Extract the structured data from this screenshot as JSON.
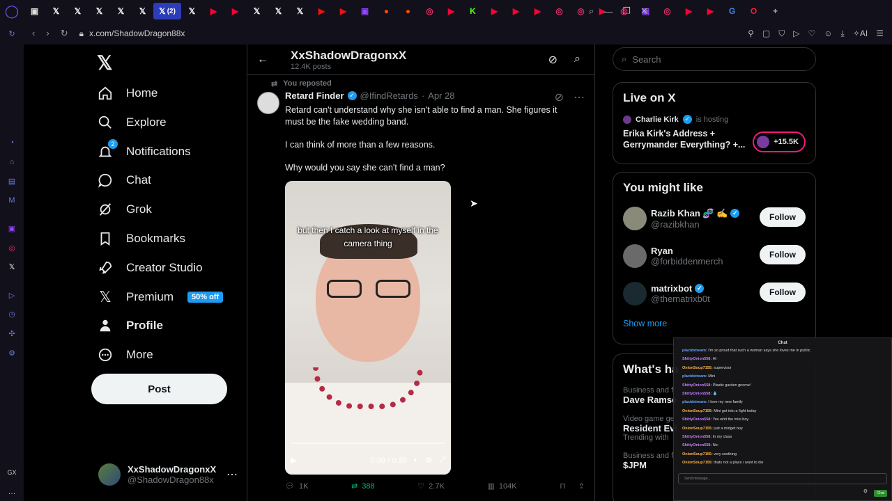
{
  "browser": {
    "tabs": [
      {
        "icon": "twitch-icon",
        "color": "#ddd"
      },
      {
        "icon": "x-icon",
        "color": "#fff"
      },
      {
        "icon": "x-icon",
        "color": "#fff"
      },
      {
        "icon": "x-icon",
        "color": "#fff"
      },
      {
        "icon": "x-icon",
        "color": "#fff"
      },
      {
        "icon": "x-icon",
        "color": "#fff"
      },
      {
        "icon": "x-icon-active",
        "color": "#fff"
      },
      {
        "icon": "x-icon",
        "color": "#fff"
      },
      {
        "icon": "youtube-icon",
        "color": "#ff0033"
      },
      {
        "icon": "youtube-icon",
        "color": "#ff0033"
      },
      {
        "icon": "x-icon",
        "color": "#fff"
      },
      {
        "icon": "x-icon",
        "color": "#fff"
      },
      {
        "icon": "x-icon",
        "color": "#fff"
      },
      {
        "icon": "play-icon",
        "color": "#e11"
      },
      {
        "icon": "play-icon",
        "color": "#e11"
      },
      {
        "icon": "twitch-icon",
        "color": "#9146ff"
      },
      {
        "icon": "reddit-icon",
        "color": "#ff4500"
      },
      {
        "icon": "reddit-icon",
        "color": "#ff4500"
      },
      {
        "icon": "instagram-icon",
        "color": "#e1306c"
      },
      {
        "icon": "youtube-icon",
        "color": "#ff0033"
      },
      {
        "icon": "kick-icon",
        "color": "#53fc18"
      },
      {
        "icon": "youtube-icon",
        "color": "#ff0033"
      },
      {
        "icon": "youtube-icon",
        "color": "#ff0033"
      },
      {
        "icon": "youtube-icon",
        "color": "#ff0033"
      },
      {
        "icon": "instagram-icon",
        "color": "#e1306c"
      },
      {
        "icon": "instagram-icon",
        "color": "#e1306c"
      },
      {
        "icon": "youtube-icon",
        "color": "#ff0033"
      },
      {
        "icon": "instagram-icon",
        "color": "#e1306c"
      },
      {
        "icon": "twitch-icon",
        "color": "#9146ff"
      },
      {
        "icon": "instagram-icon",
        "color": "#e1306c"
      },
      {
        "icon": "youtube-icon",
        "color": "#ff0033"
      },
      {
        "icon": "youtube-icon",
        "color": "#ff0033"
      },
      {
        "icon": "google-icon",
        "color": "#4285f4"
      },
      {
        "icon": "opera-icon",
        "color": "#ff1b2d"
      }
    ],
    "active_tab_count": "(2)",
    "url": "x.com/ShadowDragon88x",
    "ai_label": "AI"
  },
  "nav": {
    "items": [
      {
        "label": "Home",
        "icon": "home-icon"
      },
      {
        "label": "Explore",
        "icon": "search-icon"
      },
      {
        "label": "Notifications",
        "icon": "bell-icon",
        "badge": "2"
      },
      {
        "label": "Chat",
        "icon": "chat-icon"
      },
      {
        "label": "Grok",
        "icon": "grok-icon"
      },
      {
        "label": "Bookmarks",
        "icon": "bookmark-icon"
      },
      {
        "label": "Creator Studio",
        "icon": "rocket-icon"
      },
      {
        "label": "Premium",
        "icon": "x-logo-icon",
        "promo": "50% off"
      },
      {
        "label": "Profile",
        "icon": "person-icon"
      },
      {
        "label": "More",
        "icon": "more-circle-icon"
      }
    ],
    "post_label": "Post",
    "account": {
      "name": "XxShadowDragonxX",
      "handle": "@ShadowDragon88x"
    }
  },
  "profile_header": {
    "name": "XxShadowDragonxX",
    "posts": "12.4K posts"
  },
  "tweet": {
    "repost_note": "You reposted",
    "author": "Retard Finder",
    "handle": "@IfindRetards",
    "date": "Apr 28",
    "paragraphs": [
      "Retard can't understand why she isn't able to find a man. She figures it must be the fake wedding band.",
      "I can think of more than a few reasons.",
      "Why would you say she can't find a man?"
    ],
    "video": {
      "caption": "but then I catch a look at myself in the camera thing",
      "time": "0:00 / 0:39"
    },
    "replies": "1K",
    "reposts": "388",
    "likes": "2.7K",
    "views": "104K"
  },
  "search": {
    "placeholder": "Search"
  },
  "live": {
    "heading": "Live on X",
    "host": "Charlie Kirk",
    "hosting_label": "is hosting",
    "title": "Erika Kirk's Address + Gerrymander Everything? +...",
    "listeners": "+15.5K"
  },
  "suggestions": {
    "heading": "You might like",
    "people": [
      {
        "name": "Razib Khan 🧬 ✍️",
        "handle": "@razibkhan",
        "verified": true,
        "follow": "Follow"
      },
      {
        "name": "Ryan",
        "handle": "@forbiddenmerch",
        "verified": false,
        "follow": "Follow"
      },
      {
        "name": "matrixbot",
        "handle": "@thematrixb0t",
        "verified": true,
        "follow": "Follow"
      }
    ],
    "show_more": "Show more"
  },
  "trends": {
    "heading": "What's ha",
    "items": [
      {
        "category": "Business and f",
        "name": "Dave Ramse",
        "sub": ""
      },
      {
        "category": "Video game ge",
        "name": "Resident Evi",
        "sub": "Trending with"
      },
      {
        "category": "Business and f",
        "name": "$JPM",
        "sub": ""
      }
    ]
  },
  "chat": {
    "title": "Chat",
    "messages": [
      {
        "user": "placidstream:",
        "text": "I'm so proud that such a woman says she loves me in public.",
        "color": "#6aa7ff"
      },
      {
        "user": "ShittyOnion558:",
        "text": "Hi",
        "color": "#c77dff"
      },
      {
        "user": "OnionSoup7155:",
        "text": "supervisor",
        "color": "#ffb347"
      },
      {
        "user": "placidstream:",
        "text": "Mini",
        "color": "#6aa7ff"
      },
      {
        "user": "ShittyOnion558:",
        "text": "Plastic garden gnome!",
        "color": "#c77dff"
      },
      {
        "user": "ShittyOnion558:",
        "text": "💧",
        "color": "#c77dff"
      },
      {
        "user": "placidstream:",
        "text": "I love my new family",
        "color": "#6aa7ff"
      },
      {
        "user": "OnionSoup7155:",
        "text": "Mini got into a fight today",
        "color": "#ffb347"
      },
      {
        "user": "ShittyOnion558:",
        "text": "Yes whit the mini boy",
        "color": "#c77dff"
      },
      {
        "user": "OnionSoup7155:",
        "text": "just a midget boy",
        "color": "#ffb347"
      },
      {
        "user": "ShittyOnion558:",
        "text": "In my class",
        "color": "#c77dff"
      },
      {
        "user": "ShittyOnion558:",
        "text": "No-",
        "color": "#c77dff"
      },
      {
        "user": "OnionSoup7155:",
        "text": "very soothing",
        "color": "#ffb347"
      },
      {
        "user": "OnionSoup7155:",
        "text": "thats not a place i want to die",
        "color": "#ffb347"
      }
    ],
    "input_placeholder": "Send message...",
    "send_label": "Chat"
  }
}
